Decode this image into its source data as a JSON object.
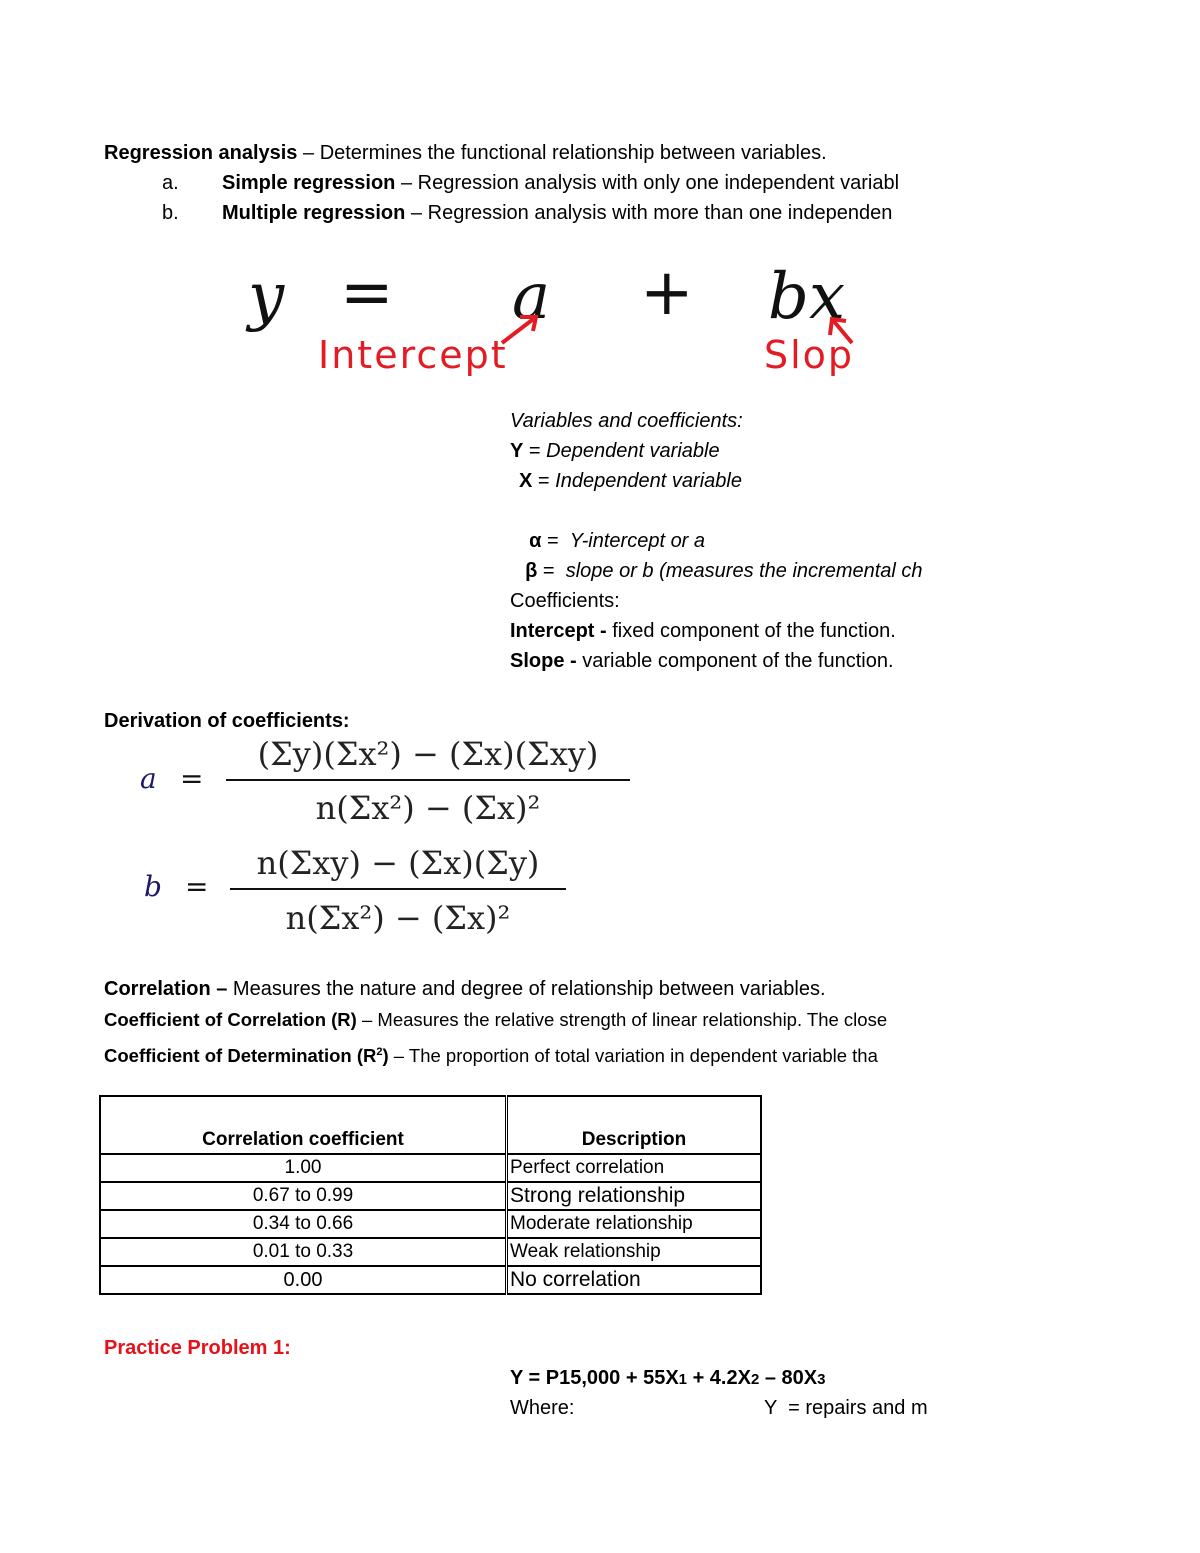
{
  "regression": {
    "term": "Regression analysis",
    "dash": " – ",
    "definition": "Determines the functional relationship between variables.",
    "items": [
      {
        "marker": "a.",
        "term": "Simple regression",
        "dash": " – ",
        "text": "Regression analysis with only one independent variabl"
      },
      {
        "marker": "b.",
        "term": "Multiple regression",
        "dash": " – ",
        "text": "Regression analysis with more than one independen"
      }
    ]
  },
  "equation": {
    "y": "y",
    "equals": "=",
    "a": "a",
    "plus": "+",
    "bx": "bx",
    "intercept_label": "Intercept",
    "slope_label": "Slop",
    "label_color": "#e31b23"
  },
  "variables": {
    "heading": "Variables and coefficients:",
    "rows": [
      {
        "symbol": "Y",
        "eq": " = ",
        "desc": "Dependent variable"
      },
      {
        "symbol": "X",
        "eq": " = ",
        "desc": "Independent variable"
      },
      {
        "symbol": "α",
        "eq": " =  ",
        "desc": "Y-intercept or a"
      },
      {
        "symbol": "β",
        "eq": " =  ",
        "desc": "slope or b (measures the incremental ch"
      }
    ]
  },
  "coefficients": {
    "heading": "Coefficients:",
    "rows": [
      {
        "term": "Intercept -",
        "text": " fixed component of the function."
      },
      {
        "term": "Slope -",
        "text": " variable component of the function."
      }
    ]
  },
  "derivation": {
    "heading": "Derivation of coefficients:",
    "a": {
      "lhs": "a",
      "eq": "=",
      "numerator": "(Σy)(Σx²) − (Σx)(Σxy)",
      "denominator": "n(Σx²) − (Σx)²"
    },
    "b": {
      "lhs": "b",
      "eq": "=",
      "numerator": "n(Σxy) − (Σx)(Σy)",
      "denominator": "n(Σx²) − (Σx)²"
    }
  },
  "correlation": {
    "lines": [
      {
        "term": "Correlation –",
        "text": " Measures the nature and degree of relationship between variables."
      },
      {
        "term": "Coefficient of Correlation (R)",
        "text": " – Measures the relative strength of linear relationship. The close"
      },
      {
        "term": "Coefficient of Determination (R",
        "sup": "2",
        "term_end": ")",
        "text": " – The proportion of total variation in dependent variable tha"
      }
    ]
  },
  "table": {
    "headers": [
      "Correlation coefficient",
      "Description"
    ],
    "rows": [
      [
        "1.00",
        "Perfect correlation"
      ],
      [
        "0.67 to 0.99",
        "Strong relationship"
      ],
      [
        "0.34 to 0.66",
        "Moderate relationship"
      ],
      [
        "0.01 to 0.33",
        "Weak relationship"
      ],
      [
        "0.00",
        "No correlation"
      ]
    ]
  },
  "practice": {
    "heading": "Practice Problem 1:",
    "heading_color": "#e8101a",
    "equation_parts": [
      "Y = P15,000 + 55X",
      "1",
      " + 4.2X",
      "2",
      " – 80X",
      "3"
    ],
    "where_label": "Where:",
    "where_symbol": "Y",
    "where_text": "  = repairs and m"
  }
}
